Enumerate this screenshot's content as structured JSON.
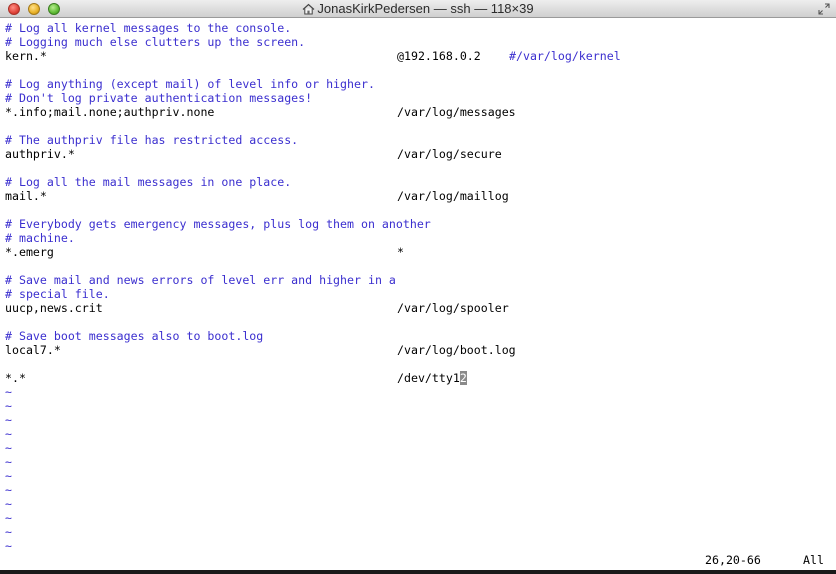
{
  "window": {
    "title": "JonasKirkPedersen — ssh — 118×39"
  },
  "icons": {
    "title_icon": "home-icon",
    "fullscreen": "fullscreen-icon"
  },
  "colors": {
    "comment": "#3b2fcf",
    "text": "#000000",
    "background": "#ffffff"
  },
  "lines": [
    {
      "type": "comment",
      "text": "# Log all kernel messages to the console."
    },
    {
      "type": "comment",
      "text": "# Logging much else clutters up the screen."
    },
    {
      "type": "rule",
      "selector": "kern.*",
      "action": "@192.168.0.2",
      "trailing_comment": "#/var/log/kernel"
    },
    {
      "type": "blank",
      "text": ""
    },
    {
      "type": "comment",
      "text": "# Log anything (except mail) of level info or higher."
    },
    {
      "type": "comment",
      "text": "# Don't log private authentication messages!"
    },
    {
      "type": "rule",
      "selector": "*.info;mail.none;authpriv.none",
      "action": "/var/log/messages"
    },
    {
      "type": "blank",
      "text": ""
    },
    {
      "type": "comment",
      "text": "# The authpriv file has restricted access."
    },
    {
      "type": "rule",
      "selector": "authpriv.*",
      "action": "/var/log/secure"
    },
    {
      "type": "blank",
      "text": ""
    },
    {
      "type": "comment",
      "text": "# Log all the mail messages in one place."
    },
    {
      "type": "rule",
      "selector": "mail.*",
      "action": "/var/log/maillog"
    },
    {
      "type": "blank",
      "text": ""
    },
    {
      "type": "comment",
      "text": "# Everybody gets emergency messages, plus log them on another"
    },
    {
      "type": "comment",
      "text": "# machine."
    },
    {
      "type": "rule",
      "selector": "*.emerg",
      "action": "*"
    },
    {
      "type": "blank",
      "text": ""
    },
    {
      "type": "comment",
      "text": "# Save mail and news errors of level err and higher in a"
    },
    {
      "type": "comment",
      "text": "# special file."
    },
    {
      "type": "rule",
      "selector": "uucp,news.crit",
      "action": "/var/log/spooler"
    },
    {
      "type": "blank",
      "text": ""
    },
    {
      "type": "comment",
      "text": "# Save boot messages also to boot.log"
    },
    {
      "type": "rule",
      "selector": "local7.*",
      "action": "/var/log/boot.log"
    },
    {
      "type": "blank",
      "text": ""
    },
    {
      "type": "cursor_rule",
      "selector": "*.*",
      "action_before": "/dev/tty1",
      "cursor_char": "2"
    }
  ],
  "tilde_char": "~",
  "tilde_count": 12,
  "status": {
    "position": "26,20-66",
    "scroll": "All"
  }
}
